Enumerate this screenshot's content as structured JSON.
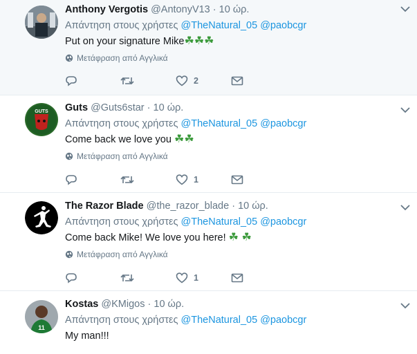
{
  "tweets": [
    {
      "name": "Anthony Vergotis",
      "handle": "@AntonyV13",
      "time": "10 ώρ.",
      "reply_prefix": "Απάντηση στους χρήστες",
      "mention1": "@TheNatural_05",
      "mention2": "@paobcgr",
      "text": "Put on your signature Mike",
      "clovers": "☘☘☘",
      "translate": "Μετάφραση από Αγγλικά",
      "likes": "2"
    },
    {
      "name": "Guts",
      "handle": "@Guts6star",
      "time": "10 ώρ.",
      "reply_prefix": "Απάντηση στους χρήστες",
      "mention1": "@TheNatural_05",
      "mention2": "@paobcgr",
      "text": "Come back we love you",
      "clovers": "☘☘",
      "translate": "Μετάφραση από Αγγλικά",
      "likes": "1"
    },
    {
      "name": "The Razor Blade",
      "handle": "@the_razor_blade",
      "time": "10 ώρ.",
      "reply_prefix": "Απάντηση στους χρήστες",
      "mention1": "@TheNatural_05",
      "mention2": "@paobcgr",
      "text": "Come back Mike! We love you here!",
      "clovers": "☘ ☘",
      "translate": "Μετάφραση από Αγγλικά",
      "likes": "1"
    },
    {
      "name": "Kostas",
      "handle": "@KMigos",
      "time": "10 ώρ.",
      "reply_prefix": "Απάντηση στους χρήστες",
      "mention1": "@TheNatural_05",
      "mention2": "@paobcgr",
      "text": "My man!!!"
    }
  ],
  "dot": "·",
  "colors": {
    "accent": "#1b95e0",
    "muted": "#657786",
    "clover": "#3b9a3b"
  },
  "icons": [
    "reply-icon",
    "retweet-icon",
    "heart-icon",
    "mail-icon",
    "globe-icon",
    "chevron-down-icon"
  ]
}
